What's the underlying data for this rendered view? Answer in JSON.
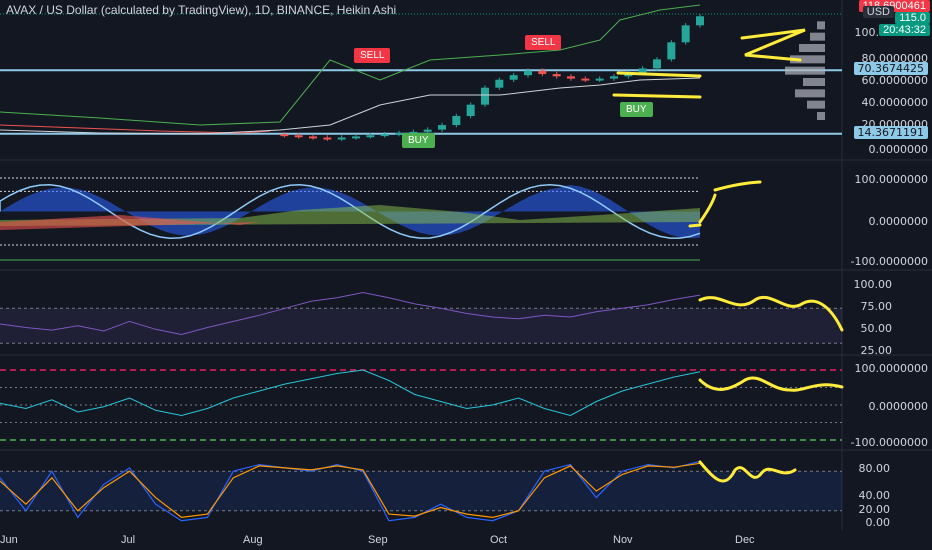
{
  "chart_data": {
    "type": "line",
    "title": "AVAX / US Dollar (calculated by TradingView), 1D, BINANCE, Heikin Ashi",
    "x_labels": [
      "Jun",
      "Jul",
      "Aug",
      "Sep",
      "Oct",
      "Nov",
      "Dec"
    ],
    "price_pane": {
      "y_ticks": [
        "100.0000000",
        "80.0000000",
        "60.0000000",
        "40.0000000",
        "20.0000000",
        "0.0000000"
      ],
      "last_price": "115.0",
      "high_marker": "118.6900461",
      "currency": "USD",
      "countdown": "20:43:32",
      "resistance": "70.3674425",
      "support": "14.3671191",
      "signals": [
        {
          "label": "SELL",
          "kind": "sell"
        },
        {
          "label": "SELL",
          "kind": "sell"
        },
        {
          "label": "BUY",
          "kind": "buy"
        },
        {
          "label": "BUY",
          "kind": "buy"
        }
      ],
      "closes": [
        14,
        13,
        12,
        11,
        10,
        11,
        12,
        13,
        14,
        15,
        16,
        18,
        22,
        30,
        40,
        55,
        62,
        66,
        70,
        67,
        65,
        63,
        62,
        63,
        65,
        68,
        72,
        80,
        95,
        110,
        118
      ]
    },
    "oscillator_pane": {
      "y_ticks": [
        "100.0000000",
        "0.0000000",
        "-100.0000000"
      ]
    },
    "rsi_pane": {
      "y_ticks": [
        "100.00",
        "75.00",
        "50.00",
        "25.00"
      ],
      "values": [
        52,
        48,
        45,
        50,
        44,
        55,
        46,
        40,
        48,
        55,
        62,
        70,
        78,
        82,
        88,
        82,
        75,
        70,
        64,
        60,
        58,
        62,
        60,
        66,
        70,
        74,
        80,
        85
      ]
    },
    "cci_pane": {
      "y_ticks": [
        "100.0000000",
        "0.0000000",
        "-100.0000000"
      ],
      "values": [
        5,
        -10,
        15,
        -20,
        -5,
        20,
        -15,
        -30,
        -10,
        20,
        40,
        60,
        75,
        90,
        100,
        70,
        30,
        10,
        -10,
        0,
        20,
        -10,
        -30,
        10,
        40,
        60,
        80,
        95
      ]
    },
    "stoch_pane": {
      "y_ticks": [
        "80.00",
        "40.00",
        "20.00",
        "0.00"
      ],
      "k_values": [
        70,
        20,
        80,
        10,
        60,
        85,
        30,
        5,
        10,
        80,
        90,
        85,
        80,
        90,
        80,
        5,
        10,
        30,
        10,
        5,
        20,
        80,
        90,
        40,
        80,
        90,
        85,
        95
      ],
      "d_values": [
        65,
        30,
        70,
        20,
        55,
        80,
        40,
        10,
        15,
        70,
        88,
        85,
        82,
        88,
        82,
        15,
        12,
        25,
        15,
        10,
        20,
        70,
        88,
        50,
        75,
        88,
        86,
        92
      ]
    }
  }
}
